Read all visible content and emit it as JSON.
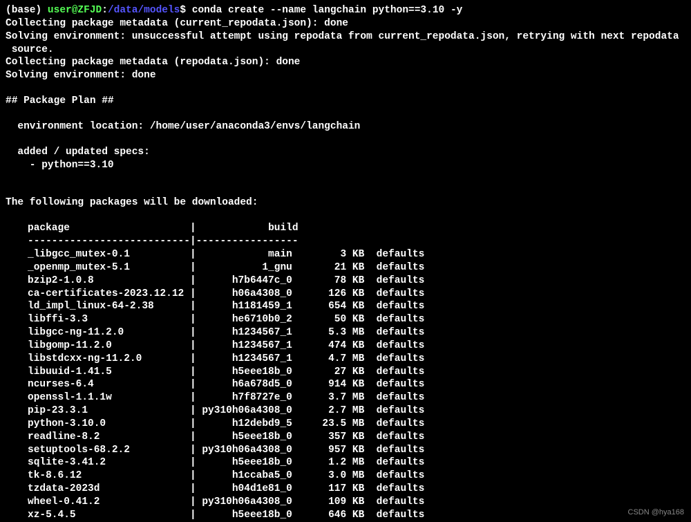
{
  "prompt": {
    "prefix": "(base) ",
    "user_host": "user@ZFJD",
    "colon": ":",
    "path": "/data/models",
    "dollar": "$ ",
    "command": "conda create --name langchain python==3.10 -y"
  },
  "output_lines": [
    "Collecting package metadata (current_repodata.json): done",
    "Solving environment: unsuccessful attempt using repodata from current_repodata.json, retrying with next repodata",
    " source.",
    "Collecting package metadata (repodata.json): done",
    "Solving environment: done"
  ],
  "package_plan_header": "## Package Plan ##",
  "env_location": "  environment location: /home/user/anaconda3/envs/langchain",
  "added_specs_header": "  added / updated specs:",
  "added_spec": "    - python==3.10",
  "download_header": "The following packages will be downloaded:",
  "table": {
    "header_package": "package",
    "header_build": "build",
    "separator": "---------------------------|-----------------",
    "rows": [
      {
        "pkg": "_libgcc_mutex-0.1",
        "build": "main",
        "size": "3 KB",
        "channel": "defaults"
      },
      {
        "pkg": "_openmp_mutex-5.1",
        "build": "1_gnu",
        "size": "21 KB",
        "channel": "defaults"
      },
      {
        "pkg": "bzip2-1.0.8",
        "build": "h7b6447c_0",
        "size": "78 KB",
        "channel": "defaults"
      },
      {
        "pkg": "ca-certificates-2023.12.12",
        "build": "h06a4308_0",
        "size": "126 KB",
        "channel": "defaults"
      },
      {
        "pkg": "ld_impl_linux-64-2.38",
        "build": "h1181459_1",
        "size": "654 KB",
        "channel": "defaults"
      },
      {
        "pkg": "libffi-3.3",
        "build": "he6710b0_2",
        "size": "50 KB",
        "channel": "defaults"
      },
      {
        "pkg": "libgcc-ng-11.2.0",
        "build": "h1234567_1",
        "size": "5.3 MB",
        "channel": "defaults"
      },
      {
        "pkg": "libgomp-11.2.0",
        "build": "h1234567_1",
        "size": "474 KB",
        "channel": "defaults"
      },
      {
        "pkg": "libstdcxx-ng-11.2.0",
        "build": "h1234567_1",
        "size": "4.7 MB",
        "channel": "defaults"
      },
      {
        "pkg": "libuuid-1.41.5",
        "build": "h5eee18b_0",
        "size": "27 KB",
        "channel": "defaults"
      },
      {
        "pkg": "ncurses-6.4",
        "build": "h6a678d5_0",
        "size": "914 KB",
        "channel": "defaults"
      },
      {
        "pkg": "openssl-1.1.1w",
        "build": "h7f8727e_0",
        "size": "3.7 MB",
        "channel": "defaults"
      },
      {
        "pkg": "pip-23.3.1",
        "build": "py310h06a4308_0",
        "size": "2.7 MB",
        "channel": "defaults"
      },
      {
        "pkg": "python-3.10.0",
        "build": "h12debd9_5",
        "size": "23.5 MB",
        "channel": "defaults"
      },
      {
        "pkg": "readline-8.2",
        "build": "h5eee18b_0",
        "size": "357 KB",
        "channel": "defaults"
      },
      {
        "pkg": "setuptools-68.2.2",
        "build": "py310h06a4308_0",
        "size": "957 KB",
        "channel": "defaults"
      },
      {
        "pkg": "sqlite-3.41.2",
        "build": "h5eee18b_0",
        "size": "1.2 MB",
        "channel": "defaults"
      },
      {
        "pkg": "tk-8.6.12",
        "build": "h1ccaba5_0",
        "size": "3.0 MB",
        "channel": "defaults"
      },
      {
        "pkg": "tzdata-2023d",
        "build": "h04d1e81_0",
        "size": "117 KB",
        "channel": "defaults"
      },
      {
        "pkg": "wheel-0.41.2",
        "build": "py310h06a4308_0",
        "size": "109 KB",
        "channel": "defaults"
      },
      {
        "pkg": "xz-5.4.5",
        "build": "h5eee18b_0",
        "size": "646 KB",
        "channel": "defaults"
      }
    ]
  },
  "watermark": "CSDN @hya168"
}
